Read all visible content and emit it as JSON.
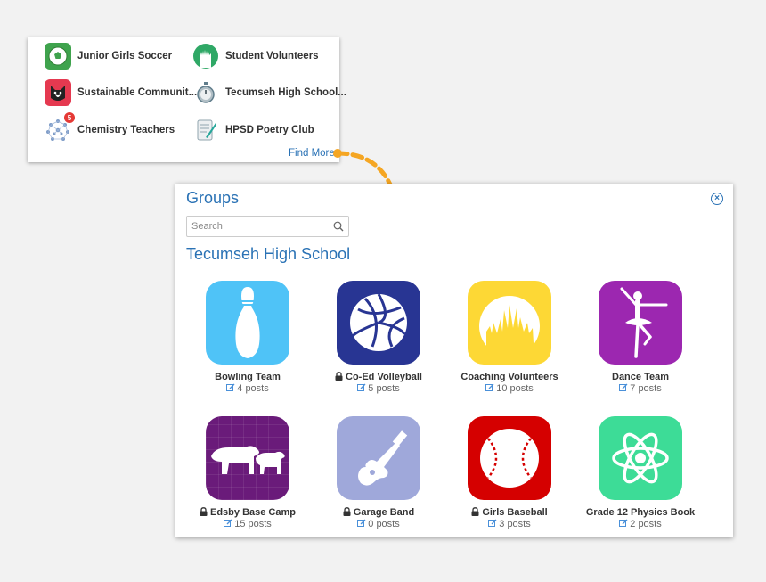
{
  "mini_groups": [
    {
      "label": "Junior Girls Soccer",
      "icon": "soccer-ball-icon"
    },
    {
      "label": "Student Volunteers",
      "icon": "raised-hands-icon"
    },
    {
      "label": "Sustainable Communit...",
      "icon": "dog-icon"
    },
    {
      "label": "Tecumseh High School...",
      "icon": "stopwatch-icon"
    },
    {
      "label": "Chemistry Teachers",
      "icon": "molecule-icon",
      "badge": "5"
    },
    {
      "label": "HPSD Poetry Club",
      "icon": "scroll-quill-icon"
    }
  ],
  "find_more": "Find More",
  "panel": {
    "title": "Groups",
    "search_placeholder": "Search",
    "school": "Tecumseh High School"
  },
  "groups": [
    {
      "name": "Bowling Team",
      "posts": "4 posts",
      "locked": false,
      "color": "#4fc3f7",
      "icon": "bowling-pin-icon"
    },
    {
      "name": "Co-Ed Volleyball",
      "posts": "5 posts",
      "locked": true,
      "color": "#283593",
      "icon": "volleyball-icon"
    },
    {
      "name": "Coaching Volunteers",
      "posts": "10 posts",
      "locked": false,
      "color": "#fdd835",
      "icon": "raised-hands-icon"
    },
    {
      "name": "Dance Team",
      "posts": "7 posts",
      "locked": false,
      "color": "#9c27b0",
      "icon": "dancer-icon"
    },
    {
      "name": "Edsby Base Camp",
      "posts": "15 posts",
      "locked": true,
      "color": "#6a1b7a",
      "icon": "bears-icon"
    },
    {
      "name": "Garage Band",
      "posts": "0 posts",
      "locked": true,
      "color": "#9fa8da",
      "icon": "guitar-icon"
    },
    {
      "name": "Girls Baseball",
      "posts": "3 posts",
      "locked": true,
      "color": "#d50000",
      "icon": "baseball-icon"
    },
    {
      "name": "Grade 12 Physics Book",
      "posts": "2 posts",
      "locked": false,
      "color": "#3ddc97",
      "icon": "atom-icon"
    }
  ],
  "colors": {
    "accent": "#2a72b5",
    "arrow": "#f5a623"
  }
}
